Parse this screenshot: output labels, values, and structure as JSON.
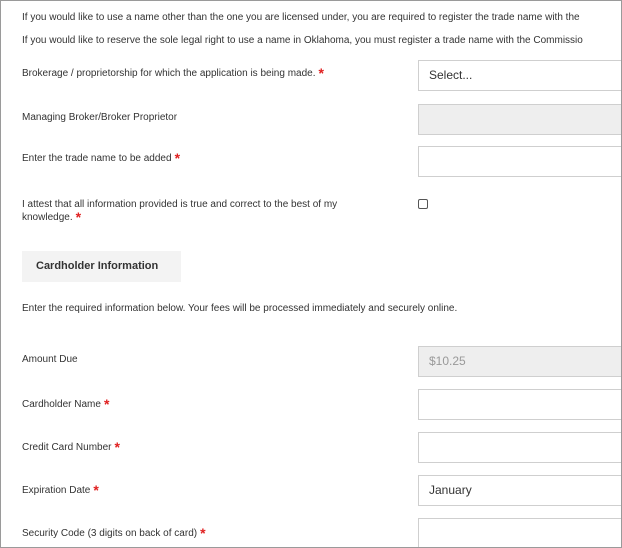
{
  "intro": {
    "line1": "If you would like to use a name other than the one you are licensed under, you are required to register the trade name with the",
    "line2": "If you would like to reserve the sole legal right to use a name in Oklahoma, you must register a trade name with the Commissio"
  },
  "form": {
    "brokerage": {
      "label": "Brokerage / proprietorship for which the application is being made.",
      "required": "*",
      "value": "Select..."
    },
    "managing_broker": {
      "label": "Managing Broker/Broker Proprietor",
      "value": ""
    },
    "trade_name": {
      "label": "Enter the trade name to be added",
      "required": "*",
      "value": ""
    },
    "attest": {
      "label": "I attest that all information provided is true and correct to the best of my knowledge.",
      "required": "*",
      "checked": false
    }
  },
  "cardholder": {
    "section_title": "Cardholder Information",
    "description": "Enter the required information below. Your fees will be processed immediately and securely online.",
    "amount_due": {
      "label": "Amount Due",
      "value": "$10.25"
    },
    "name": {
      "label": "Cardholder Name",
      "required": "*",
      "value": ""
    },
    "card_number": {
      "label": "Credit Card Number",
      "required": "*",
      "value": ""
    },
    "expiration": {
      "label": "Expiration Date",
      "required": "*",
      "value": "January"
    },
    "security_code": {
      "label": "Security Code (3 digits on back of card)",
      "required": "*",
      "value": ""
    }
  },
  "colors": {
    "required": "#e02020",
    "disabled_bg": "#eeeeee",
    "section_bg": "#f3f3f3"
  }
}
